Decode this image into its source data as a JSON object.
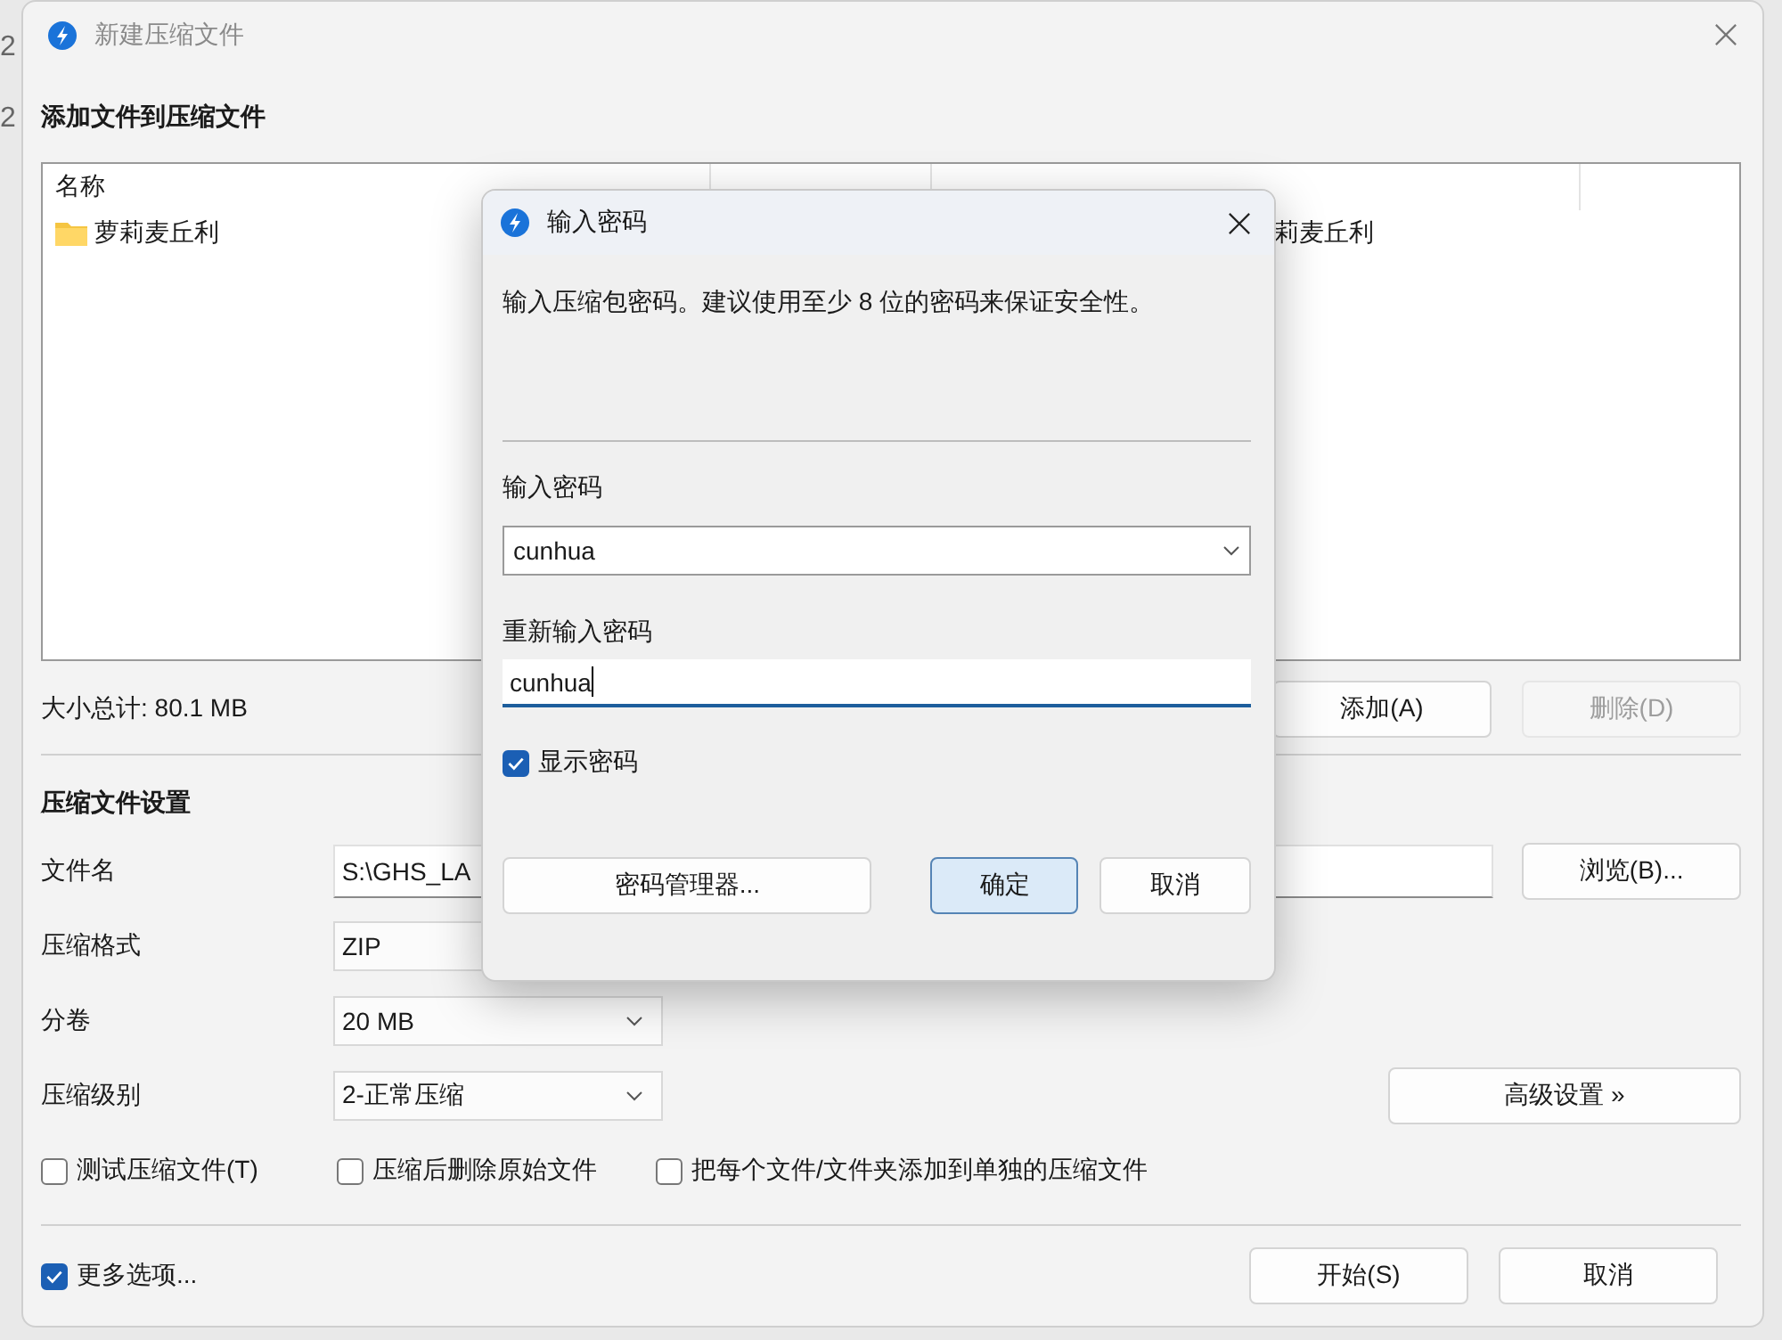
{
  "background_texts": [
    "2",
    "2"
  ],
  "window": {
    "title": "新建压缩文件",
    "active": false
  },
  "files_section": {
    "title": "添加文件到压缩文件",
    "columns": [
      "名称"
    ],
    "rows": [
      {
        "name": "萝莉麦丘利",
        "path": "莉麦丘利"
      }
    ],
    "total": "大小总计: 80.1 MB",
    "buttons": [
      {
        "label": "添加(A)",
        "disabled": false
      },
      {
        "label": "删除(D)",
        "disabled": true
      }
    ]
  },
  "settings": {
    "title": "压缩文件设置",
    "fields": [
      {
        "kind": "text",
        "label": "文件名",
        "value": "S:\\GHS_LA",
        "button": "浏览(B)..."
      },
      {
        "kind": "select",
        "label": "压缩格式",
        "value": "ZIP"
      },
      {
        "kind": "select",
        "label": "分卷",
        "value": "20 MB"
      },
      {
        "kind": "select",
        "label": "压缩级别",
        "value": "2-正常压缩",
        "button": "高级设置 »"
      }
    ],
    "options": [
      {
        "label": "测试压缩文件(T)",
        "checked": false
      },
      {
        "label": "压缩后删除原始文件",
        "checked": false
      },
      {
        "label": "把每个文件/文件夹添加到单独的压缩文件",
        "checked": false
      }
    ]
  },
  "more_options": {
    "label": "更多选项...",
    "checked": true
  },
  "buttons": [
    "开始(S)",
    "取消"
  ],
  "dialog": {
    "title": "输入密码",
    "description": "输入压缩包密码。建议使用至少 8 位的密码来保证安全性。",
    "password_label": "输入密码",
    "password_value": "cunhua",
    "confirm_label": "重新输入密码",
    "confirm_value": "cunhua",
    "show_password": {
      "label": "显示密码",
      "checked": true
    },
    "buttons": [
      {
        "label": "密码管理器...",
        "default": false
      },
      {
        "label": "确定",
        "default": true
      },
      {
        "label": "取消",
        "default": false
      }
    ]
  }
}
